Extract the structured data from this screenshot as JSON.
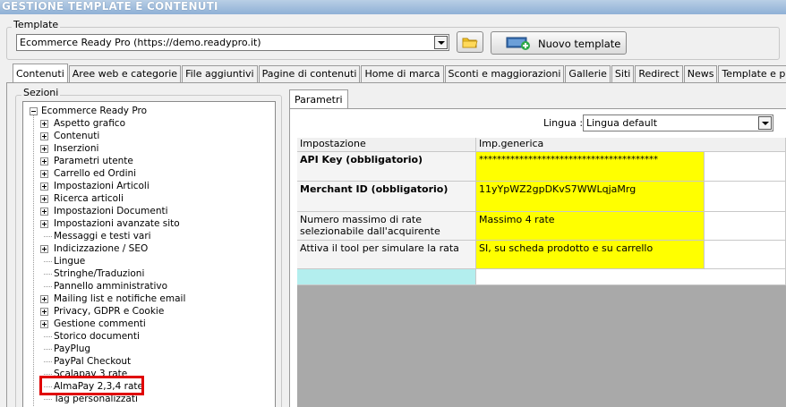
{
  "window": {
    "title": "GESTIONE TEMPLATE E CONTENUTI"
  },
  "template_group": {
    "label": "Template",
    "selected": "Ecommerce Ready Pro (https://demo.readypro.it)",
    "new_button": "Nuovo template"
  },
  "tabs": [
    "Contenuti",
    "Aree web e categorie",
    "File aggiuntivi",
    "Pagine di contenuti",
    "Home di marca",
    "Sconti e maggiorazioni",
    "Gallerie",
    "Siti",
    "Redirect",
    "News",
    "Template e plugins"
  ],
  "sections": {
    "label": "Sezioni",
    "root": "Ecommerce Ready Pro",
    "items": [
      {
        "label": "Aspetto grafico",
        "expandable": true
      },
      {
        "label": "Contenuti",
        "expandable": true
      },
      {
        "label": "Inserzioni",
        "expandable": true
      },
      {
        "label": "Parametri utente",
        "expandable": true
      },
      {
        "label": "Carrello ed Ordini",
        "expandable": true
      },
      {
        "label": "Impostazioni Articoli",
        "expandable": true
      },
      {
        "label": "Ricerca articoli",
        "expandable": true
      },
      {
        "label": "Impostazioni Documenti",
        "expandable": true
      },
      {
        "label": "Impostazioni avanzate sito",
        "expandable": true
      },
      {
        "label": "Messaggi e testi vari",
        "expandable": false
      },
      {
        "label": "Indicizzazione / SEO",
        "expandable": true
      },
      {
        "label": "Lingue",
        "expandable": false
      },
      {
        "label": "Stringhe/Traduzioni",
        "expandable": false
      },
      {
        "label": "Pannello amministrativo",
        "expandable": false
      },
      {
        "label": "Mailing list e notifiche email",
        "expandable": true
      },
      {
        "label": "Privacy, GDPR e Cookie",
        "expandable": true
      },
      {
        "label": "Gestione commenti",
        "expandable": true
      },
      {
        "label": "Storico documenti",
        "expandable": false
      },
      {
        "label": "PayPlug",
        "expandable": false
      },
      {
        "label": "PayPal Checkout",
        "expandable": false
      },
      {
        "label": "Scalapay 3 rate",
        "expandable": false
      },
      {
        "label": "AlmaPay 2,3,4 rate",
        "expandable": false
      },
      {
        "label": "Tag personalizzati",
        "expandable": false
      }
    ],
    "highlighted_index": 21
  },
  "params": {
    "tab": "Parametri",
    "language_label": "Lingua :",
    "language_value": "Lingua default",
    "columns": [
      "Impostazione",
      "Imp.generica"
    ],
    "rows": [
      {
        "setting": "API Key (obbligatorio)",
        "value": "****************************************",
        "bold": true
      },
      {
        "setting": "Merchant ID (obbligatorio)",
        "value": "11yYpWZ2gpDKvS7WWLqjaMrg",
        "bold": true
      },
      {
        "setting": "Numero massimo di rate selezionabile dall'acquirente",
        "value": "Massimo 4 rate",
        "bold": false
      },
      {
        "setting": "Attiva il tool per simulare la rata",
        "value": "SI, su scheda prodotto e su carrello",
        "bold": false
      }
    ]
  },
  "colors": {
    "value_cell": "#ffff00",
    "new_row": "#b3eeee",
    "highlight": "#e00000",
    "grid_empty": "#a9a9a9"
  }
}
